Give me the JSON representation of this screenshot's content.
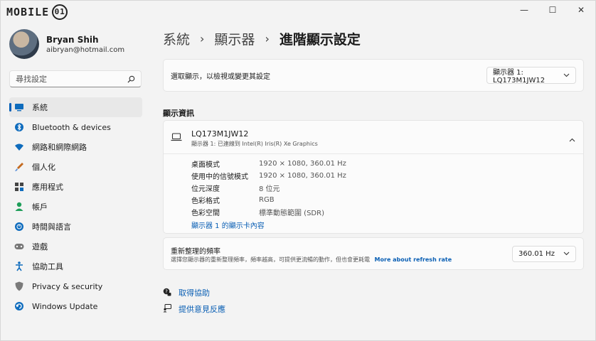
{
  "titlebar": {
    "logo_text": "MOBILE",
    "logo_badge": "01",
    "minimize": "—",
    "maximize": "☐",
    "close": "✕"
  },
  "profile": {
    "name": "Bryan Shih",
    "email": "aibryan@hotmail.com"
  },
  "search": {
    "placeholder": "尋找設定"
  },
  "sidebar": {
    "items": [
      {
        "label": "系統",
        "icon": "monitor-icon",
        "color": "#0f6cbd"
      },
      {
        "label": "Bluetooth & devices",
        "icon": "bluetooth-icon",
        "color": "#0f6cbd"
      },
      {
        "label": "網路和網際網路",
        "icon": "wifi-icon",
        "color": "#0f6cbd"
      },
      {
        "label": "個人化",
        "icon": "brush-icon",
        "color": "#c46a1f"
      },
      {
        "label": "應用程式",
        "icon": "apps-icon",
        "color": "#444444"
      },
      {
        "label": "帳戶",
        "icon": "person-icon",
        "color": "#1f9e5a"
      },
      {
        "label": "時間與語言",
        "icon": "globe-icon",
        "color": "#0f6cbd"
      },
      {
        "label": "遊戲",
        "icon": "gamepad-icon",
        "color": "#666666"
      },
      {
        "label": "協助工具",
        "icon": "accessibility-icon",
        "color": "#0f6cbd"
      },
      {
        "label": "Privacy & security",
        "icon": "shield-icon",
        "color": "#666666"
      },
      {
        "label": "Windows Update",
        "icon": "update-icon",
        "color": "#0f6cbd"
      }
    ]
  },
  "breadcrumb": {
    "level1": "系統",
    "level2": "顯示器",
    "current": "進階顯示設定",
    "separator": "›"
  },
  "select_display": {
    "label": "選取顯示，以檢視或變更其設定",
    "value": "顯示器 1: LQ173M1JW12"
  },
  "display_info": {
    "section_title": "顯示資訊",
    "monitor_name": "LQ173M1JW12",
    "monitor_sub": "顯示器 1: 已連線到 Intel(R) Iris(R) Xe Graphics",
    "rows": [
      {
        "key": "桌面模式",
        "value": "1920 × 1080, 360.01 Hz"
      },
      {
        "key": "使用中的信號模式",
        "value": "1920 × 1080, 360.01 Hz"
      },
      {
        "key": "位元深度",
        "value": "8 位元"
      },
      {
        "key": "色彩格式",
        "value": "RGB"
      },
      {
        "key": "色彩空間",
        "value": "標準動態範圍 (SDR)"
      }
    ],
    "adapter_link": "顯示器 1 的顯示卡內容"
  },
  "refresh": {
    "title": "重新整理的頻率",
    "desc": "選擇您顯示器的重新整理頻率，頻率越高，可提供更流暢的動作，但也會更耗電",
    "more_link": "More about refresh rate",
    "value": "360.01 Hz"
  },
  "help": {
    "get_help": "取得協助",
    "feedback": "提供意見反應"
  },
  "colors": {
    "accent": "#005fb8",
    "link": "#0a5fb4"
  }
}
